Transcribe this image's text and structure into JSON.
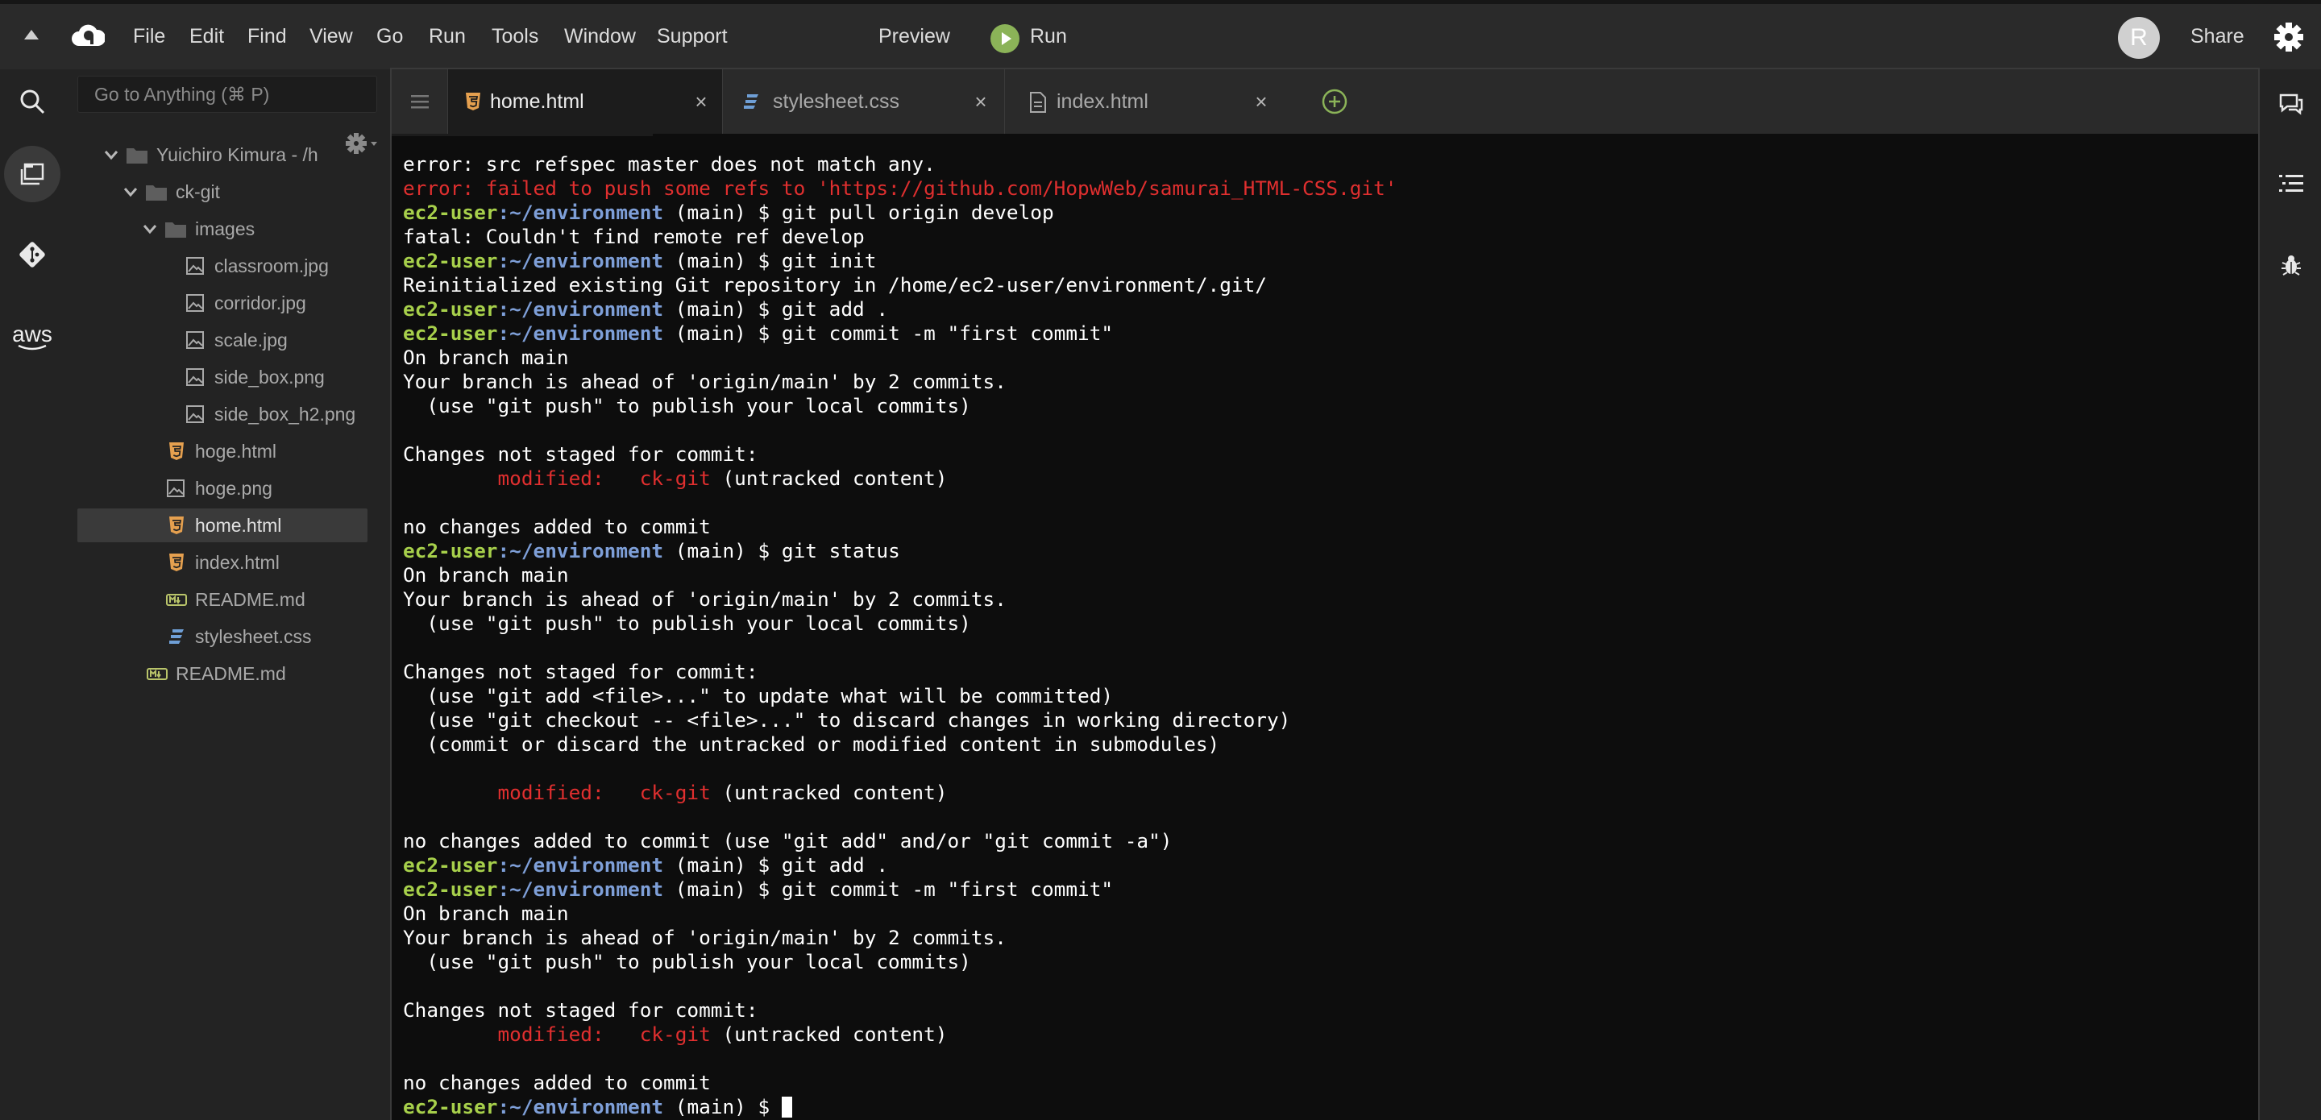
{
  "menubar": {
    "items": [
      "File",
      "Edit",
      "Find",
      "View",
      "Go",
      "Run",
      "Tools",
      "Window",
      "Support"
    ],
    "preview_label": "Preview",
    "run_label": "Run",
    "avatar_letter": "R",
    "share_label": "Share"
  },
  "sidebar": {
    "goto_placeholder": "Go to Anything (⌘ P)",
    "rail_icons": [
      "search-icon",
      "files-icon",
      "source-control-icon",
      "aws-icon"
    ],
    "aws_label": "aws"
  },
  "tree": {
    "root": "Yuichiro Kimura - /hc",
    "items": [
      {
        "label": "ck-git",
        "kind": "folder"
      },
      {
        "label": "images",
        "kind": "folder"
      },
      {
        "label": "classroom.jpg",
        "kind": "image"
      },
      {
        "label": "corridor.jpg",
        "kind": "image"
      },
      {
        "label": "scale.jpg",
        "kind": "image"
      },
      {
        "label": "side_box.png",
        "kind": "image"
      },
      {
        "label": "side_box_h2.png",
        "kind": "image"
      },
      {
        "label": "hoge.html",
        "kind": "html"
      },
      {
        "label": "hoge.png",
        "kind": "image"
      },
      {
        "label": "home.html",
        "kind": "html",
        "selected": true
      },
      {
        "label": "index.html",
        "kind": "html"
      },
      {
        "label": "README.md",
        "kind": "markdown"
      },
      {
        "label": "stylesheet.css",
        "kind": "css"
      },
      {
        "label": "README.md",
        "kind": "markdown"
      }
    ]
  },
  "tabs": [
    {
      "label": "home.html",
      "active": true
    },
    {
      "label": "stylesheet.css",
      "active": false
    },
    {
      "label": "index.html",
      "active": false
    }
  ],
  "terminal": {
    "user": "ec2-user",
    "path": ":~/environment",
    "lines": [
      "error: src refspec master does not match any.",
      "error: failed to push some refs to 'https://github.com/HopwWeb/samurai_HTML-CSS.git'",
      " (main) $ git pull origin develop",
      "fatal: Couldn't find remote ref develop",
      " (main) $ git init",
      "Reinitialized existing Git repository in /home/ec2-user/environment/.git/",
      " (main) $ git add .",
      " (main) $ git commit -m \"first commit\"",
      "On branch main",
      "Your branch is ahead of 'origin/main' by 2 commits.",
      "  (use \"git push\" to publish your local commits)",
      "",
      "Changes not staged for commit:",
      "        modified:   ck-git",
      " (untracked content)",
      "",
      "no changes added to commit",
      " (main) $ git status",
      "On branch main",
      "Your branch is ahead of 'origin/main' by 2 commits.",
      "  (use \"git push\" to publish your local commits)",
      "",
      "Changes not staged for commit:",
      "  (use \"git add <file>...\" to update what will be committed)",
      "  (use \"git checkout -- <file>...\" to discard changes in working directory)",
      "  (commit or discard the untracked or modified content in submodules)",
      "",
      "        modified:   ck-git",
      " (untracked content)",
      "",
      "no changes added to commit (use \"git add\" and/or \"git commit -a\")",
      " (main) $ git add .",
      " (main) $ git commit -m \"first commit\"",
      "On branch main",
      "Your branch is ahead of 'origin/main' by 2 commits.",
      "  (use \"git push\" to publish your local commits)",
      "",
      "Changes not staged for commit:",
      "        modified:   ck-git",
      " (untracked content)",
      "",
      "no changes added to commit",
      " (main) $ "
    ]
  },
  "colors": {
    "user": "#a7d04b",
    "path": "#7e9fd8",
    "error": "#e02f2f",
    "html_icon": "#e5a04f",
    "css_icon": "#6f9fd6",
    "md_icon": "#b9c46a",
    "run_green": "#8bb358"
  }
}
